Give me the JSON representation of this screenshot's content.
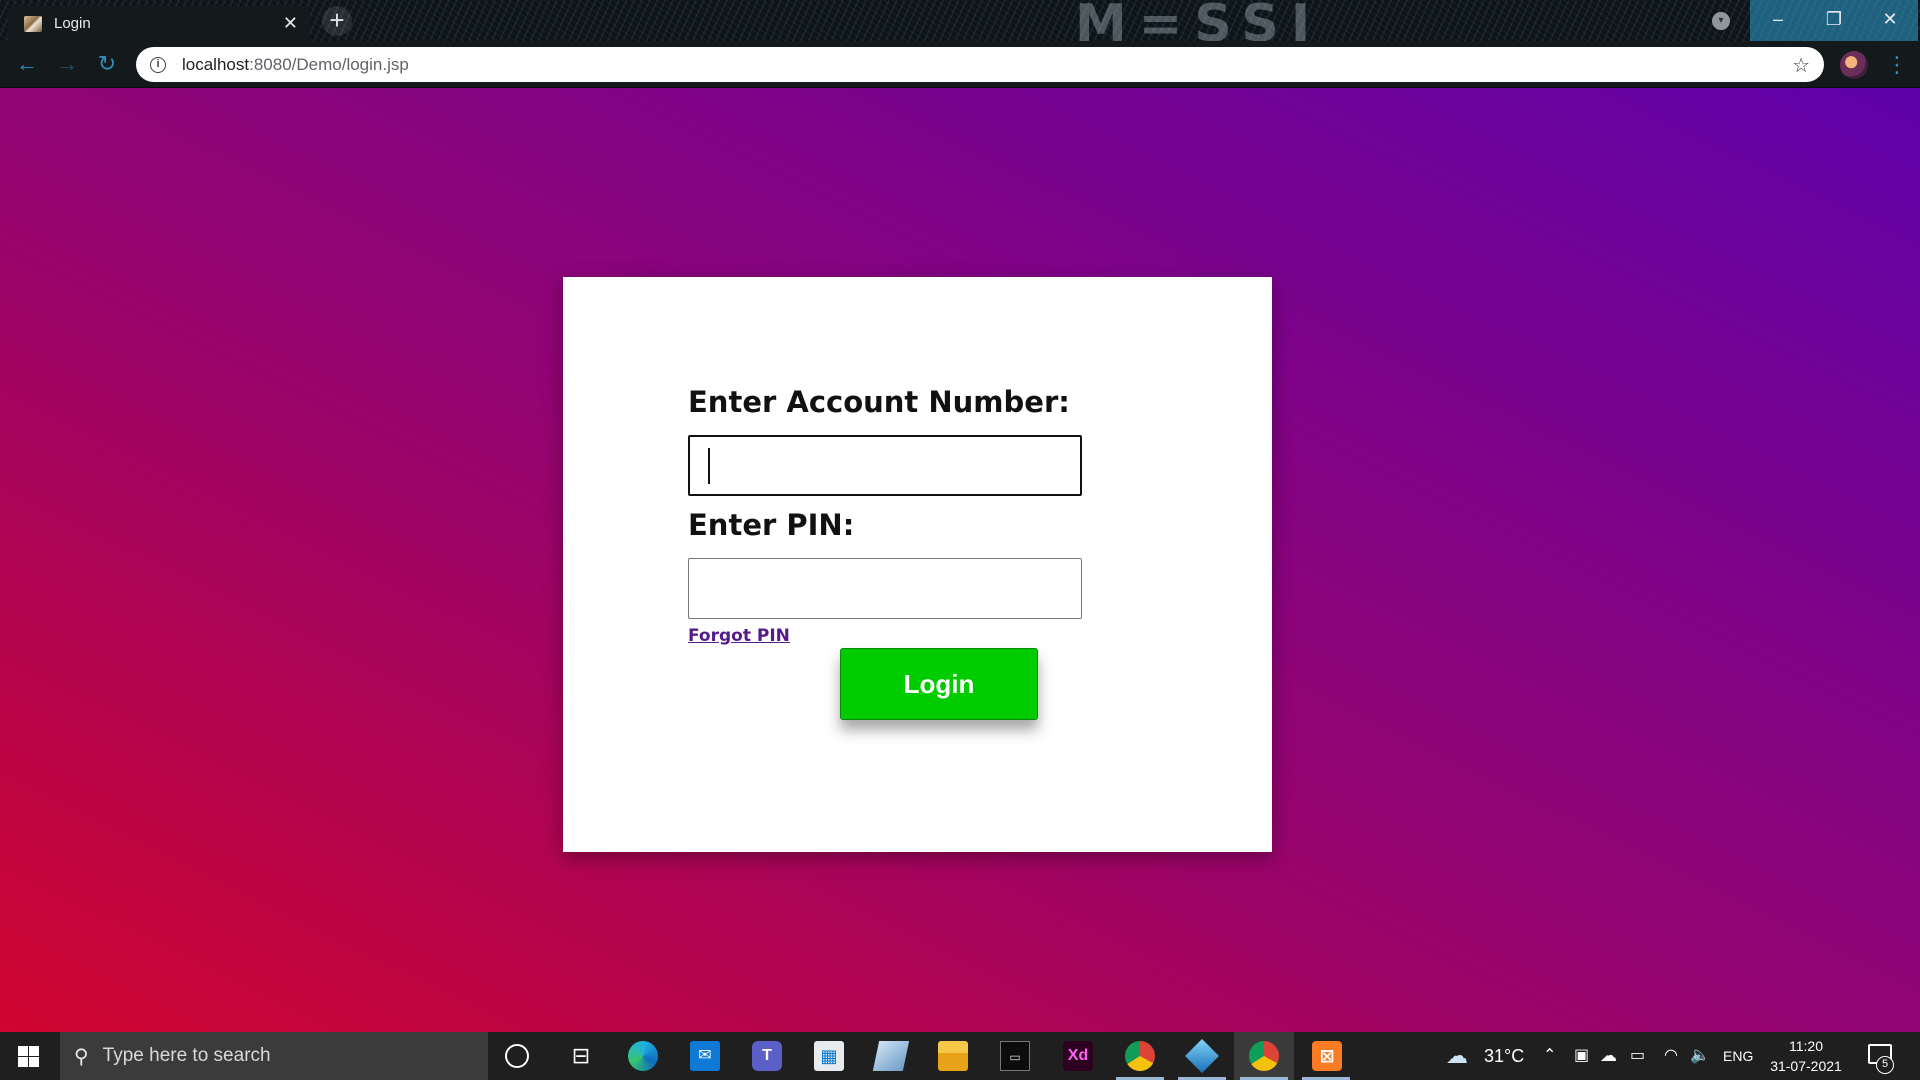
{
  "browser": {
    "tab_title": "Login",
    "tab_close": "✕",
    "new_tab": "+",
    "url_host": "localhost",
    "url_rest": ":8080/Demo/login.jsp",
    "window_controls": {
      "minimize": "–",
      "maximize": "❐",
      "close": "✕"
    },
    "icons": {
      "back": "←",
      "forward": "→",
      "reload": "↻",
      "info": "i",
      "star": "☆",
      "menu": "⋮"
    }
  },
  "login": {
    "account_label": "Enter Account Number:",
    "account_value": "",
    "pin_label": "Enter PIN:",
    "pin_value": "",
    "forgot_link": "Forgot PIN",
    "submit_label": "Login"
  },
  "taskbar": {
    "search_placeholder": "Type here to search",
    "xd_label": "Xd",
    "weather_temp": "31°C",
    "language": "ENG",
    "time": "11:20",
    "date": "31-07-2021",
    "notification_count": "5"
  },
  "colors": {
    "gradient_start": "#d0052f",
    "gradient_end": "#5f02aa",
    "login_button": "#00cc00",
    "link": "#551a8b"
  }
}
